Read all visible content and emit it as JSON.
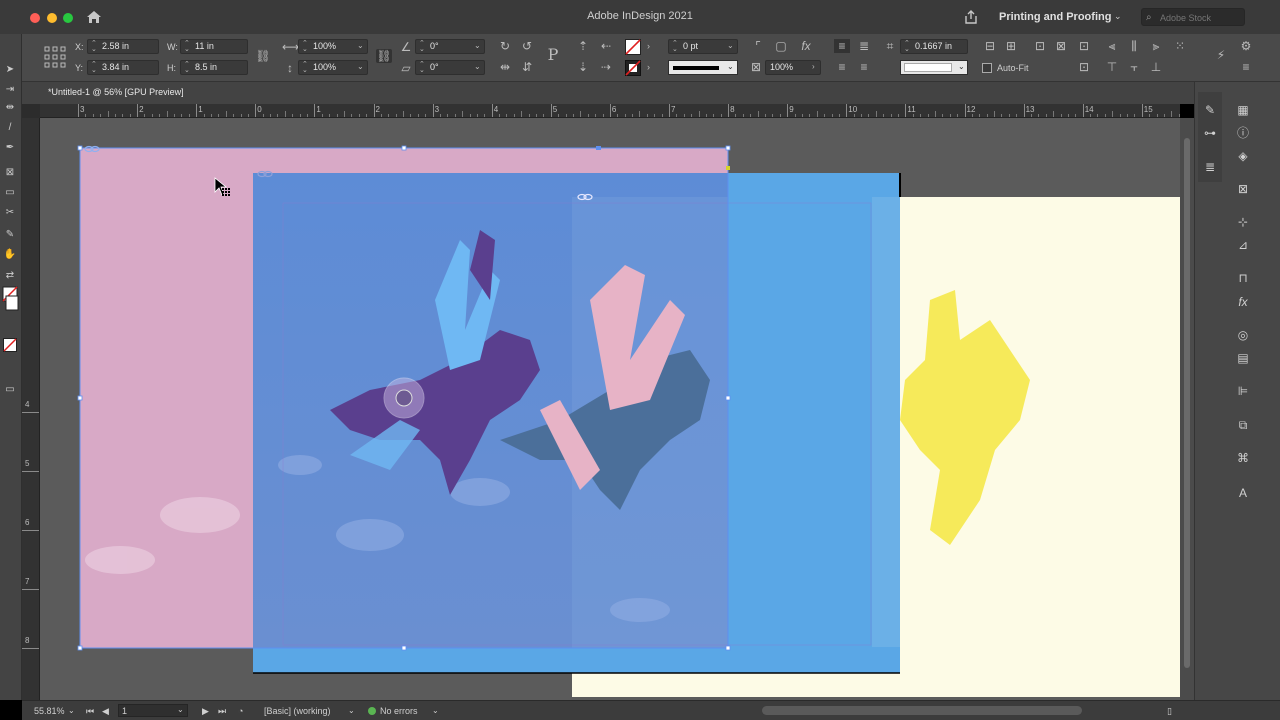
{
  "app": {
    "title": "Adobe InDesign 2021",
    "workspace": "Printing and Proofing",
    "stock_placeholder": "Adobe Stock"
  },
  "control": {
    "x_label": "X:",
    "x_value": "2.58 in",
    "y_label": "Y:",
    "y_value": "3.84 in",
    "w_label": "W:",
    "w_value": "11 in",
    "h_label": "H:",
    "h_value": "8.5 in",
    "scale_x": "100%",
    "scale_y": "100%",
    "rotate": "0°",
    "shear": "0°",
    "stroke_weight": "0 pt",
    "opacity": "100%",
    "fitting_value": "0.1667 in",
    "autofit_label": "Auto-Fit"
  },
  "document": {
    "tab_title": "*Untitled-1 @ 56% [GPU Preview]"
  },
  "ruler": {
    "h_ticks": [
      "3",
      "2",
      "1",
      "0",
      "1",
      "2",
      "3",
      "4",
      "5",
      "6",
      "7",
      "8",
      "9",
      "10",
      "11",
      "12",
      "13",
      "14",
      "15"
    ],
    "v_ticks": [
      "4",
      "5",
      "6",
      "7",
      "8"
    ]
  },
  "status": {
    "zoom": "55.81%",
    "page": "1",
    "style": "[Basic] (working)",
    "errors": "No errors"
  },
  "colors": {
    "pink_page": "#d8a9c6",
    "blue_frame": "#5c8fd6",
    "light_blue": "#5aa7e6",
    "cream_page": "#fdfbe6",
    "yellow_plane": "#f5e84a"
  }
}
